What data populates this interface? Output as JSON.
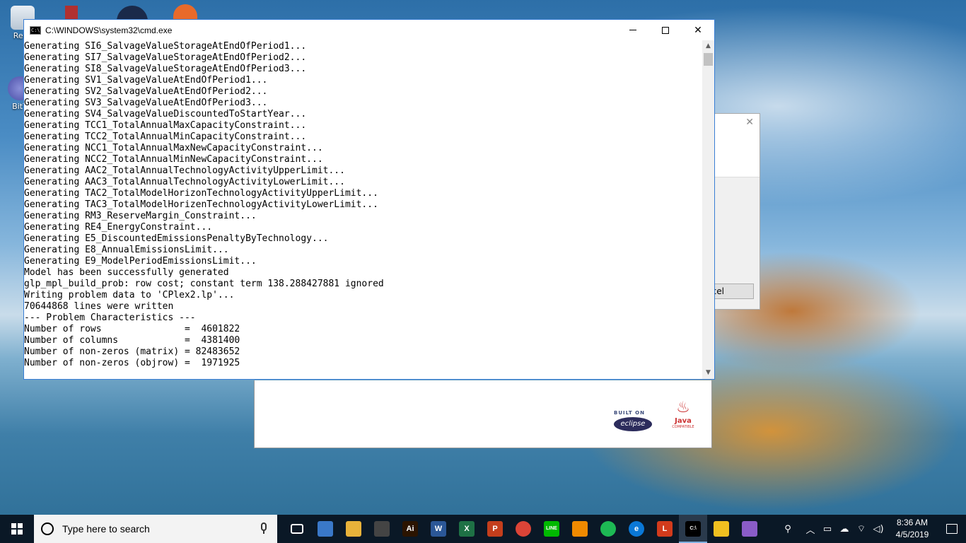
{
  "desktop": {
    "icons": [
      {
        "label": "Recy",
        "icon": "recycle-bin-icon"
      },
      {
        "label": "BitT",
        "icon": "bittorrent-icon"
      }
    ]
  },
  "background_dialog": {
    "cancel_label": "ncel",
    "brand_badge_top": "BUILT ON",
    "brand_badge_name": "eclipse",
    "java_label": "Java",
    "java_sub": "COMPATIBLE"
  },
  "cmd": {
    "title": "C:\\WINDOWS\\system32\\cmd.exe",
    "icon_text": "C:\\",
    "lines": [
      "Generating SI6_SalvageValueStorageAtEndOfPeriod1...",
      "Generating SI7_SalvageValueStorageAtEndOfPeriod2...",
      "Generating SI8_SalvageValueStorageAtEndOfPeriod3...",
      "Generating SV1_SalvageValueAtEndOfPeriod1...",
      "Generating SV2_SalvageValueAtEndOfPeriod2...",
      "Generating SV3_SalvageValueAtEndOfPeriod3...",
      "Generating SV4_SalvageValueDiscountedToStartYear...",
      "Generating TCC1_TotalAnnualMaxCapacityConstraint...",
      "Generating TCC2_TotalAnnualMinCapacityConstraint...",
      "Generating NCC1_TotalAnnualMaxNewCapacityConstraint...",
      "Generating NCC2_TotalAnnualMinNewCapacityConstraint...",
      "Generating AAC2_TotalAnnualTechnologyActivityUpperLimit...",
      "Generating AAC3_TotalAnnualTechnologyActivityLowerLimit...",
      "Generating TAC2_TotalModelHorizonTechnologyActivityUpperLimit...",
      "Generating TAC3_TotalModelHorizenTechnologyActivityLowerLimit...",
      "Generating RM3_ReserveMargin_Constraint...",
      "Generating RE4_EnergyConstraint...",
      "Generating E5_DiscountedEmissionsPenaltyByTechnology...",
      "Generating E8_AnnualEmissionsLimit...",
      "Generating E9_ModelPeriodEmissionsLimit...",
      "Model has been successfully generated",
      "glp_mpl_build_prob: row cost; constant term 138.288427881 ignored",
      "Writing problem data to 'CPlex2.lp'...",
      "70644868 lines were written",
      "--- Problem Characteristics ---",
      "Number of rows               =  4601822",
      "Number of columns            =  4381400",
      "Number of non-zeros (matrix) = 82483652",
      "Number of non-zeros (objrow) =  1971925"
    ]
  },
  "taskbar": {
    "search_placeholder": "Type here to search",
    "apps": [
      {
        "name": "task-view-icon",
        "label": "",
        "color": "#0a1826"
      },
      {
        "name": "paint-icon",
        "label": "",
        "color": "#3a78c8"
      },
      {
        "name": "file-explorer-icon",
        "label": "",
        "color": "#e8b23a"
      },
      {
        "name": "store-icon",
        "label": "",
        "color": "#444444"
      },
      {
        "name": "illustrator-icon",
        "label": "Ai",
        "color": "#2b1400"
      },
      {
        "name": "word-icon",
        "label": "W",
        "color": "#2b5797"
      },
      {
        "name": "excel-icon",
        "label": "X",
        "color": "#1e7145"
      },
      {
        "name": "powerpoint-icon",
        "label": "P",
        "color": "#c43e1c"
      },
      {
        "name": "chrome-icon",
        "label": "",
        "color": "#db4437"
      },
      {
        "name": "line-icon",
        "label": "LINE",
        "color": "#00b900"
      },
      {
        "name": "vlc-icon",
        "label": "",
        "color": "#f08a00"
      },
      {
        "name": "spotify-icon",
        "label": "",
        "color": "#1db954"
      },
      {
        "name": "edge-icon",
        "label": "e",
        "color": "#0a78d7"
      },
      {
        "name": "app-l-icon",
        "label": "L",
        "color": "#d23b1c"
      },
      {
        "name": "cmd-icon",
        "label": "C:\\",
        "color": "#000000"
      },
      {
        "name": "app-cross-icon",
        "label": "",
        "color": "#f0c020"
      },
      {
        "name": "paint3d-icon",
        "label": "",
        "color": "#8a5cc8"
      }
    ],
    "clock_time": "8:36 AM",
    "clock_date": "4/5/2019"
  }
}
